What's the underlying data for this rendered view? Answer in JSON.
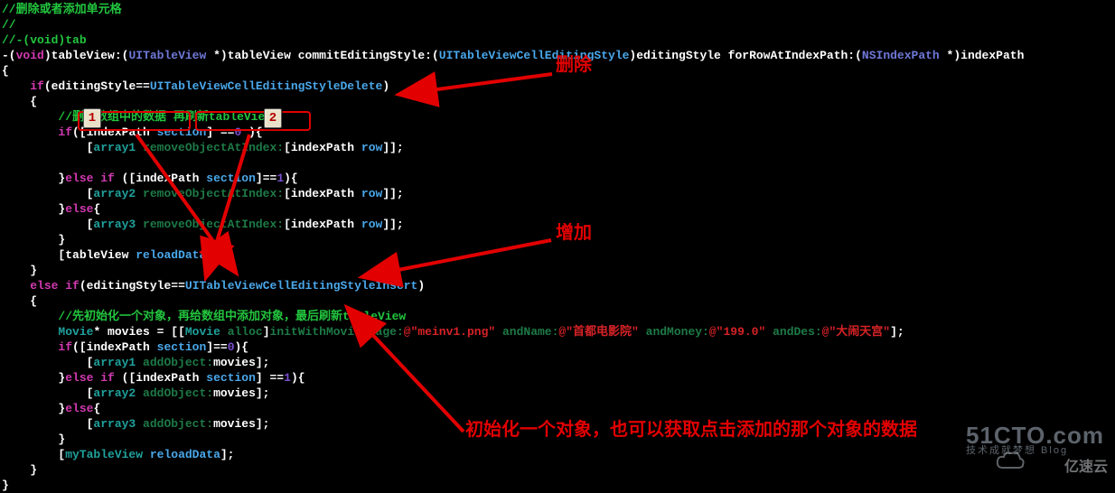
{
  "comments": {
    "top1": "//删除或者添加单元格",
    "top2": "//",
    "top3": "//-(void)tab",
    "inner1": "删除数组中的数据",
    "inner1b": "再刷新tableView",
    "inner2": "//先初始化一个对象，再给数组中添加对象，最后刷新tableView"
  },
  "sig": {
    "ret": "void",
    "m1": "tableView:",
    "p1type": "UITableView",
    "p1name": "tableView",
    "m2": "commitEditingStyle:",
    "p2type": "UITableViewCellEditingStyle",
    "p2name": "editingStyle",
    "m3": "forRowAtIndexPath:",
    "p3type": "NSIndexPath",
    "p3name": "indexPath"
  },
  "code": {
    "styleDelete": "UITableViewCellEditingStyleDelete",
    "styleInsert": "UITableViewCellEditingStyleInsert",
    "section": "section",
    "row": "row",
    "remove": "removeObjectAtIndex:",
    "add": "addObject:",
    "reload": "reloadData",
    "arr1": "array1",
    "arr2": "array2",
    "arr3": "array3",
    "tv": "tableView",
    "mytv": "myTableView",
    "movie": "Movie",
    "movies": "movies",
    "alloc": "alloc",
    "initImg": "initWithMovieImage:",
    "andName": "andName:",
    "andMoney": "andMoney:",
    "andDes": "andDes:",
    "s_img": "@\"meinv1.png\"",
    "s_name": "@\"首都电影院\"",
    "s_money": "@\"199.0\"",
    "s_des": "@\"大闹天宫\"",
    "indexPath": "indexPath",
    "n0": "0",
    "n1": "1"
  },
  "kw": {
    "if": "if",
    "else": "else"
  },
  "anno": {
    "delete": "删除",
    "add": "增加",
    "bottom": "初始化一个对象，也可以获取点击添加的那个对象的数据"
  },
  "badges": {
    "b1": "1",
    "b2": "2"
  },
  "watermark": {
    "site": "51CTO.com",
    "sub": "技术成就梦想    Blog",
    "brand": "亿速云"
  }
}
